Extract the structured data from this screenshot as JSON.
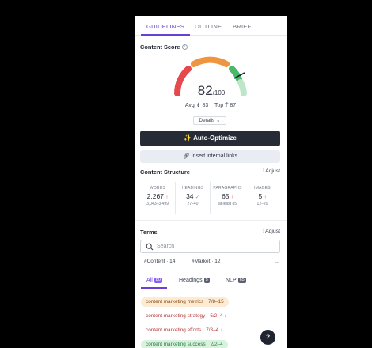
{
  "tabs": [
    {
      "label": "GUIDELINES",
      "active": true
    },
    {
      "label": "OUTLINE",
      "active": false
    },
    {
      "label": "BRIEF",
      "active": false
    }
  ],
  "content_score": {
    "title": "Content Score",
    "info_icon": "info-icon",
    "value": "82",
    "max_label": "/100",
    "avg_label": "Avg",
    "avg_value": "83",
    "top_label": "Top",
    "top_value": "87",
    "gauge_colors": {
      "low": "#e5484d",
      "mid": "#f0953f",
      "high": "#49b86a",
      "high_light": "#bfe6c9",
      "needle": "#1f2430"
    }
  },
  "details_label": "Details",
  "auto_optimize_label": "Auto-Optimize",
  "insert_links_label": "Insert internal links",
  "content_structure": {
    "title": "Content Structure",
    "adjust_label": "Adjust",
    "stats": [
      {
        "label": "WORDS",
        "value": "2,267",
        "indicator": "↑",
        "range": "3,043–3,499"
      },
      {
        "label": "HEADINGS",
        "value": "34",
        "indicator": "✓",
        "range": "27–40"
      },
      {
        "label": "PARAGRAPHS",
        "value": "65",
        "indicator": "↑",
        "range": "at least 85"
      },
      {
        "label": "IMAGES",
        "value": "5",
        "indicator": "↑",
        "range": "12–20"
      }
    ]
  },
  "terms": {
    "title": "Terms",
    "adjust_label": "Adjust",
    "search_placeholder": "Search",
    "tags": [
      "#Content · 14",
      "#Market · 12"
    ],
    "subtabs": [
      {
        "label": "All",
        "badge": "80",
        "badge_color": "#8b5cf6",
        "active": true
      },
      {
        "label": "Headings",
        "badge": "5",
        "badge_color": "#5b6170",
        "active": false
      },
      {
        "label": "NLP",
        "badge": "65",
        "badge_color": "#5b6170",
        "active": false
      }
    ],
    "items": [
      {
        "text": "content marketing metrics",
        "count": "7/8–15",
        "trend": "",
        "bg": "#fdebd3",
        "fg": "#8a4a12"
      },
      {
        "text": "content marketing strategy",
        "count": "5/2–4",
        "trend": "↓",
        "bg": "#ffffff",
        "fg": "#b23b3b"
      },
      {
        "text": "content marketing efforts",
        "count": "7/3–4",
        "trend": "↓",
        "bg": "#ffffff",
        "fg": "#b23b3b"
      },
      {
        "text": "content marketing success",
        "count": "2/2–4",
        "trend": "",
        "bg": "#d8f2de",
        "fg": "#2b7a45"
      }
    ]
  },
  "help_label": "?"
}
